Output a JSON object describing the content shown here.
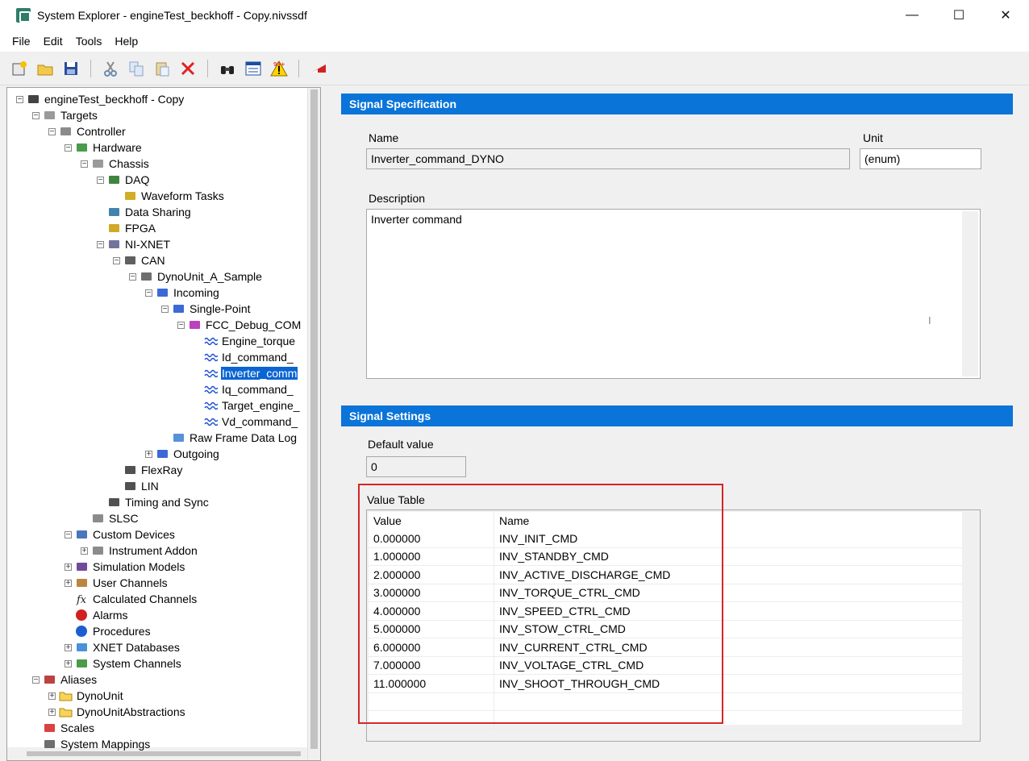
{
  "window": {
    "title": "System Explorer - engineTest_beckhoff - Copy.nivssdf",
    "minimize": "—",
    "maximize": "☐",
    "close": "✕"
  },
  "menu": [
    "File",
    "Edit",
    "Tools",
    "Help"
  ],
  "toolbar_icons": [
    "new-icon",
    "open-icon",
    "save-icon",
    "cut-icon",
    "copy-icon",
    "paste-icon",
    "delete-icon",
    "find-icon",
    "properties-icon",
    "warning-icon",
    "scales-icon"
  ],
  "tree": {
    "items": [
      {
        "label": "engineTest_beckhoff - Copy",
        "icon": "project-cube-icon"
      },
      {
        "label": "Targets",
        "icon": "targets-icon"
      },
      {
        "label": "Controller",
        "icon": "controller-icon"
      },
      {
        "label": "Hardware",
        "icon": "hardware-icon"
      },
      {
        "label": "Chassis",
        "icon": "chassis-icon"
      },
      {
        "label": "DAQ",
        "icon": "daq-icon"
      },
      {
        "label": "Waveform Tasks",
        "icon": "waveform-tasks-icon"
      },
      {
        "label": "Data Sharing",
        "icon": "data-sharing-icon"
      },
      {
        "label": "FPGA",
        "icon": "fpga-icon"
      },
      {
        "label": "NI-XNET",
        "icon": "xnet-icon"
      },
      {
        "label": "CAN",
        "icon": "can-icon"
      },
      {
        "label": "DynoUnit_A_Sample",
        "icon": "port-icon"
      },
      {
        "label": "Incoming",
        "icon": "incoming-icon"
      },
      {
        "label": "Single-Point",
        "icon": "single-point-icon"
      },
      {
        "label": "FCC_Debug_COM",
        "icon": "frame-icon"
      },
      {
        "label": "Engine_torque",
        "icon": "signal-icon"
      },
      {
        "label": "Id_command_",
        "icon": "signal-icon"
      },
      {
        "label": "Inverter_comm",
        "icon": "signal-icon"
      },
      {
        "label": "Iq_command_",
        "icon": "signal-icon"
      },
      {
        "label": "Target_engine_",
        "icon": "signal-icon"
      },
      {
        "label": "Vd_command_",
        "icon": "signal-icon"
      },
      {
        "label": "Raw Frame Data Log",
        "icon": "raw-frame-icon"
      },
      {
        "label": "Outgoing",
        "icon": "outgoing-icon"
      },
      {
        "label": "FlexRay",
        "icon": "flexray-icon"
      },
      {
        "label": "LIN",
        "icon": "lin-icon"
      },
      {
        "label": "Timing and Sync",
        "icon": "timing-icon"
      },
      {
        "label": "SLSC",
        "icon": "slsc-icon"
      },
      {
        "label": "Custom Devices",
        "icon": "custom-devices-icon"
      },
      {
        "label": "Instrument Addon",
        "icon": "instrument-icon"
      },
      {
        "label": "Simulation Models",
        "icon": "simulation-icon"
      },
      {
        "label": "User Channels",
        "icon": "user-channels-icon"
      },
      {
        "label": "Calculated Channels",
        "icon": "fx-icon"
      },
      {
        "label": "Alarms",
        "icon": "alarm-icon"
      },
      {
        "label": "Procedures",
        "icon": "procedures-icon"
      },
      {
        "label": "XNET Databases",
        "icon": "database-icon"
      },
      {
        "label": "System Channels",
        "icon": "system-channels-icon"
      },
      {
        "label": "Aliases",
        "icon": "aliases-icon"
      },
      {
        "label": "DynoUnit",
        "icon": "folder-icon"
      },
      {
        "label": "DynoUnitAbstractions",
        "icon": "folder-icon"
      },
      {
        "label": "Scales",
        "icon": "scales-icon"
      },
      {
        "label": "System Mappings",
        "icon": "mappings-icon"
      }
    ]
  },
  "signal_spec": {
    "header": "Signal Specification",
    "name_label": "Name",
    "name_value": "Inverter_command_DYNO",
    "unit_label": "Unit",
    "unit_value": "(enum)",
    "description_label": "Description",
    "description_value": "Inverter command"
  },
  "signal_settings": {
    "header": "Signal Settings",
    "default_label": "Default value",
    "default_value": "0",
    "value_table_label": "Value Table",
    "columns": [
      "Value",
      "Name"
    ],
    "rows": [
      {
        "value": "0.000000",
        "name": "INV_INIT_CMD"
      },
      {
        "value": "1.000000",
        "name": "INV_STANDBY_CMD"
      },
      {
        "value": "2.000000",
        "name": "INV_ACTIVE_DISCHARGE_CMD"
      },
      {
        "value": "3.000000",
        "name": "INV_TORQUE_CTRL_CMD"
      },
      {
        "value": "4.000000",
        "name": "INV_SPEED_CTRL_CMD"
      },
      {
        "value": "5.000000",
        "name": "INV_STOW_CTRL_CMD"
      },
      {
        "value": "6.000000",
        "name": "INV_CURRENT_CTRL_CMD"
      },
      {
        "value": "7.000000",
        "name": "INV_VOLTAGE_CTRL_CMD"
      },
      {
        "value": "11.000000",
        "name": "INV_SHOOT_THROUGH_CMD"
      }
    ]
  },
  "colors": {
    "header_blue": "#0a74d9",
    "selection_blue": "#0a64d2",
    "highlight_red": "#d42626"
  }
}
